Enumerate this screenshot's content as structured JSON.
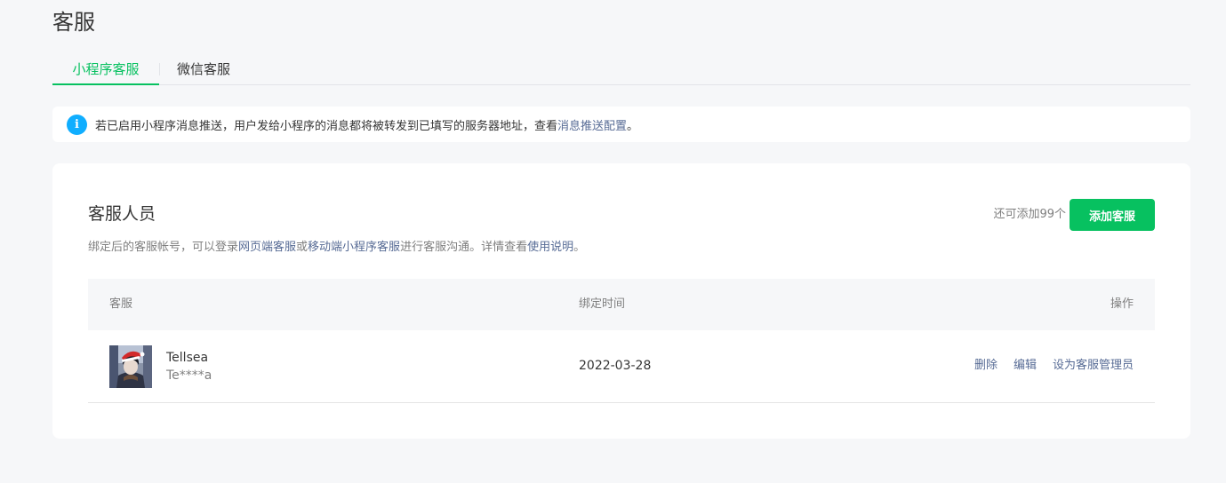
{
  "page": {
    "title": "客服"
  },
  "tabs": [
    {
      "label": "小程序客服",
      "active": true
    },
    {
      "label": "微信客服",
      "active": false
    }
  ],
  "notice": {
    "icon": "info-icon",
    "text": "若已启用小程序消息推送，用户发给小程序的消息都将被转发到已填写的服务器地址，查看 ",
    "link": "消息推送配置",
    "suffix": "。"
  },
  "staff": {
    "title": "客服人员",
    "desc_prefix": "绑定后的客服帐号，可以登录",
    "desc_link1": "网页端客服",
    "desc_mid1": "或",
    "desc_link2": "移动端小程序客服",
    "desc_mid2": "进行客服沟通。详情查看",
    "desc_link3": "使用说明",
    "desc_suffix": "。",
    "remain_text": "还可添加99个",
    "add_button": "添加客服",
    "columns": {
      "staff": "客服",
      "bind_time": "绑定时间",
      "actions": "操作"
    },
    "rows": [
      {
        "name": "Tellsea",
        "account": "Te****a",
        "bind_time": "2022-03-28",
        "actions": {
          "delete": "删除",
          "edit": "编辑",
          "set_admin": "设为客服管理员"
        }
      }
    ]
  },
  "colors": {
    "accent": "#07c160",
    "link": "#576b95",
    "info": "#10aeff",
    "background": "#f6f7f9"
  }
}
